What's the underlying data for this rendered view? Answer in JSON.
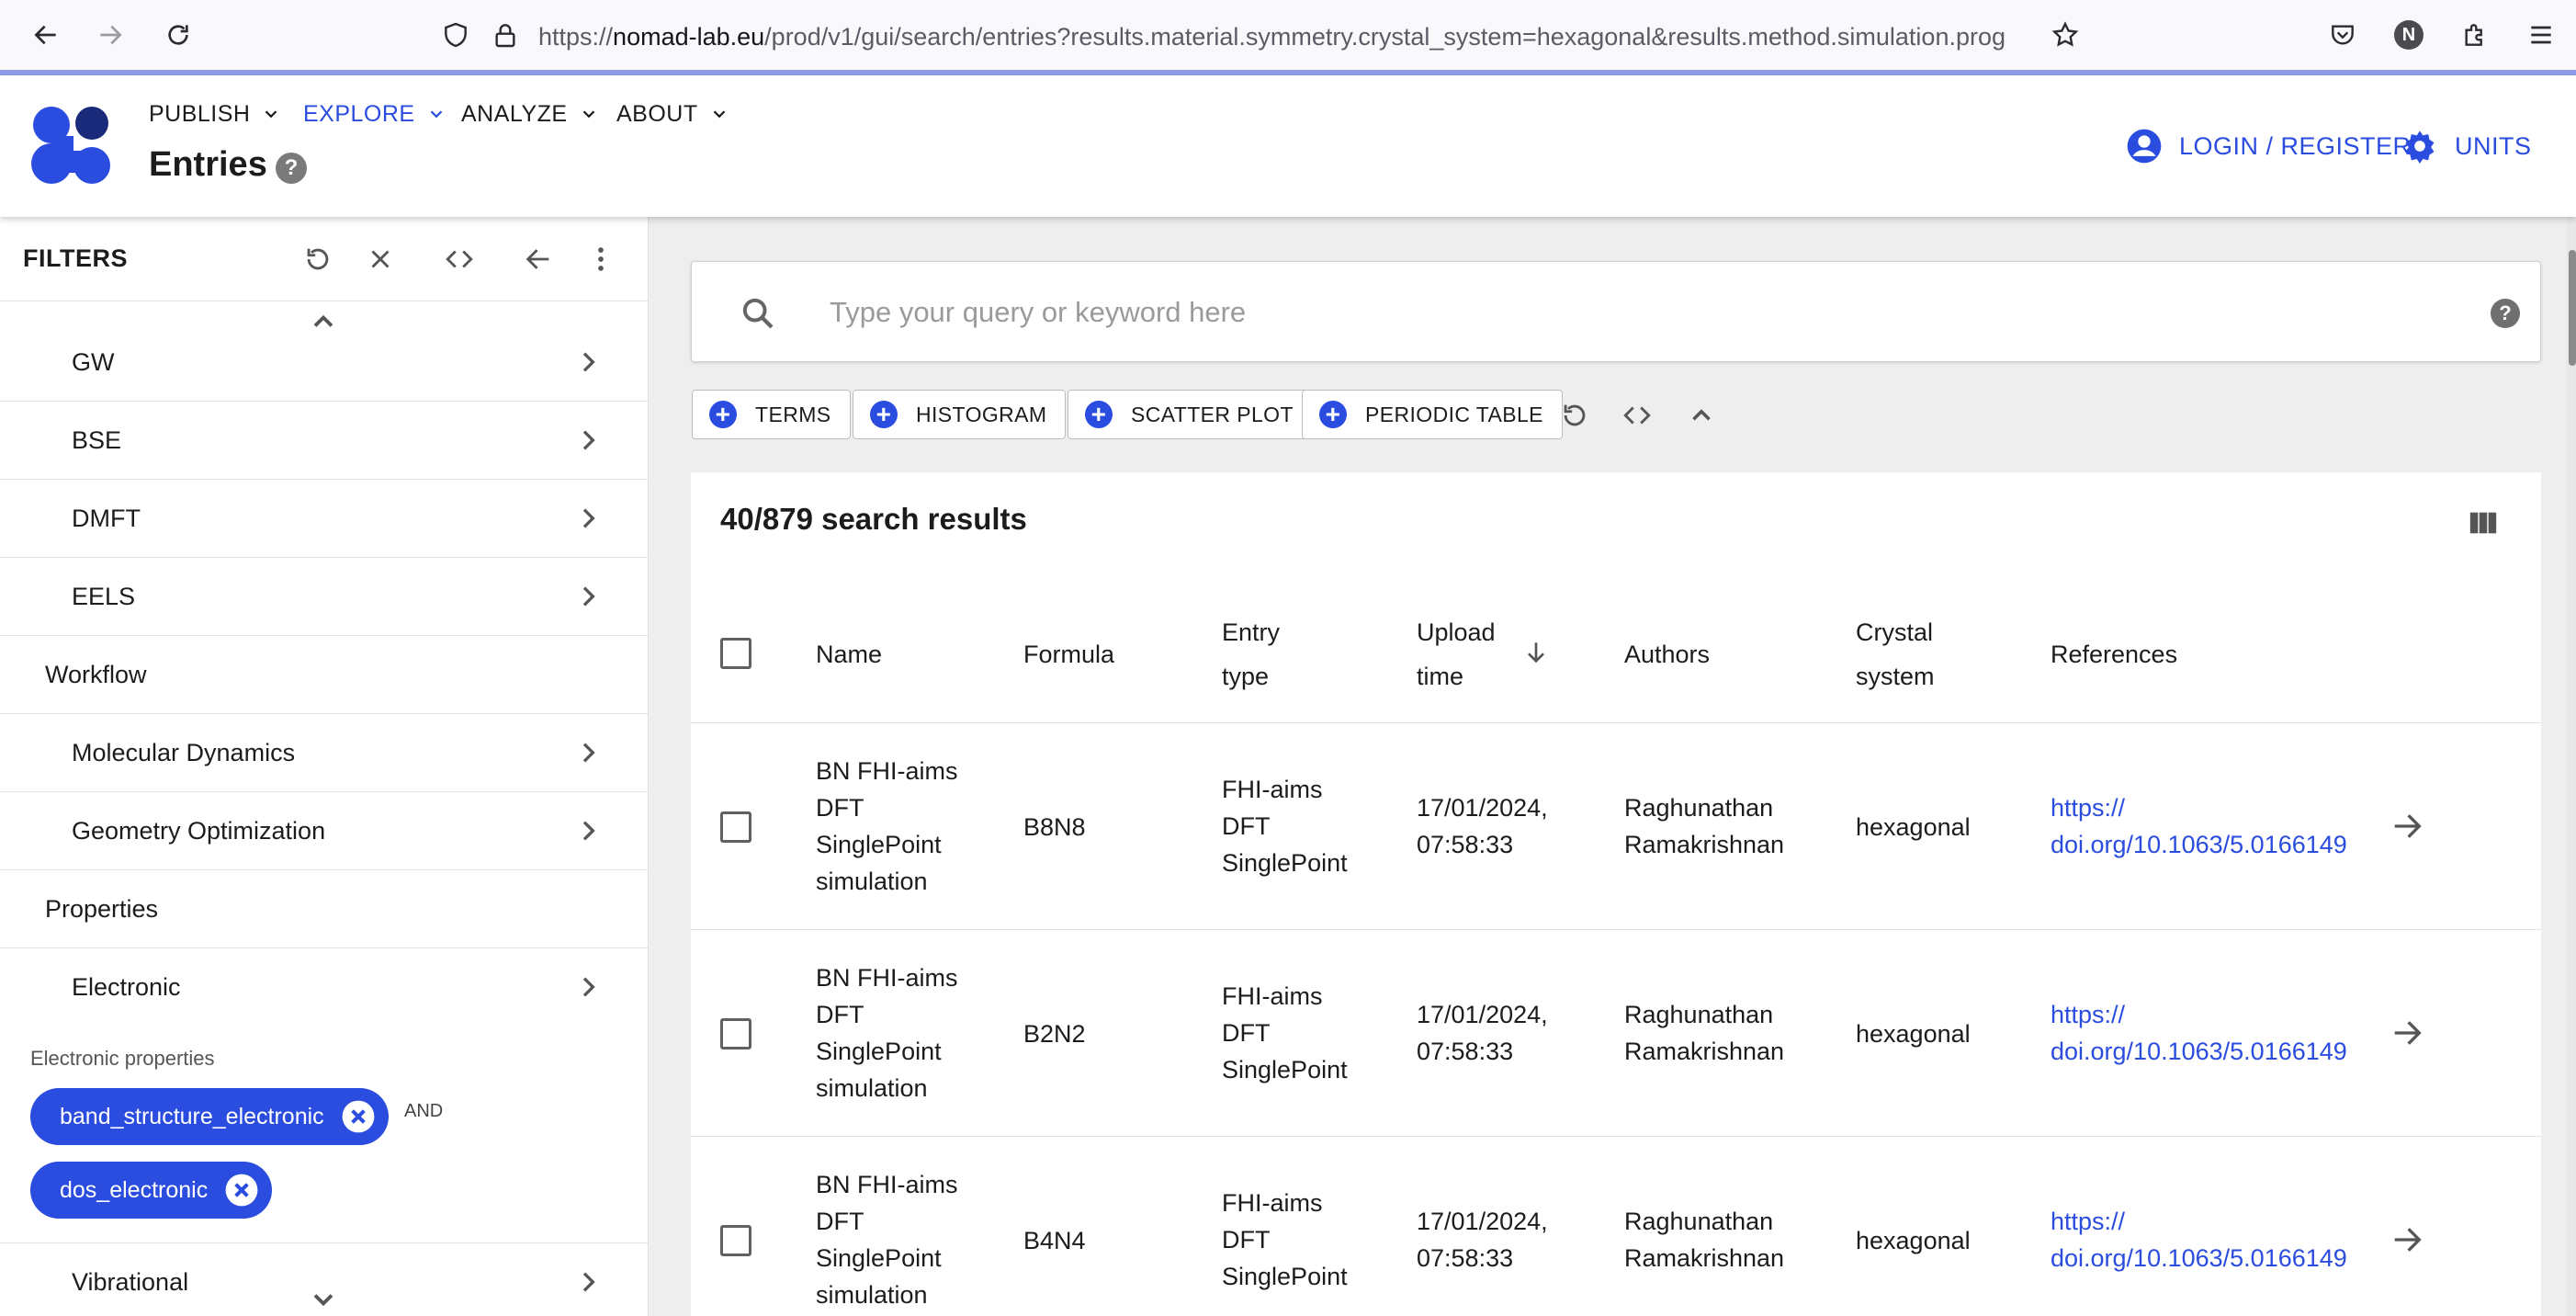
{
  "browser": {
    "url_prefix": "https://",
    "url_host": "nomad-lab.eu",
    "url_path": "/prod/v1/gui/search/entries?results.material.symmetry.crystal_system=hexagonal&results.method.simulation.prog",
    "profile_initial": "N"
  },
  "header": {
    "nav": [
      {
        "label": "PUBLISH"
      },
      {
        "label": "EXPLORE"
      },
      {
        "label": "ANALYZE"
      },
      {
        "label": "ABOUT"
      }
    ],
    "page_title": "Entries",
    "help_glyph": "?",
    "login_label": "LOGIN / REGISTER",
    "units_label": "UNITS"
  },
  "filters": {
    "title": "FILTERS",
    "items": [
      {
        "label": "GW"
      },
      {
        "label": "BSE"
      },
      {
        "label": "DMFT"
      },
      {
        "label": "EELS"
      },
      {
        "label": "Workflow"
      },
      {
        "label": "Molecular Dynamics"
      },
      {
        "label": "Geometry Optimization"
      },
      {
        "label": "Properties"
      },
      {
        "label": "Electronic"
      },
      {
        "label": "Vibrational"
      }
    ],
    "electronic_properties_label": "Electronic properties",
    "chips": [
      "band_structure_electronic",
      "dos_electronic"
    ],
    "and_label": "AND"
  },
  "search": {
    "placeholder": "Type your query or keyword here",
    "help_glyph": "?"
  },
  "widgets": [
    {
      "label": "TERMS"
    },
    {
      "label": "HISTOGRAM"
    },
    {
      "label": "SCATTER PLOT"
    },
    {
      "label": "PERIODIC TABLE"
    }
  ],
  "results": {
    "count": "40/879 search results",
    "columns": {
      "name": "Name",
      "formula": "Formula",
      "entry_type_1": "Entry",
      "entry_type_2": "type",
      "upload_time_1": "Upload",
      "upload_time_2": "time",
      "authors": "Authors",
      "crystal_1": "Crystal",
      "crystal_2": "system",
      "references": "References"
    },
    "rows": [
      {
        "name": [
          "BN FHI-aims",
          "DFT",
          "SinglePoint",
          "simulation"
        ],
        "formula": "B8N8",
        "entry_type": [
          "FHI-aims",
          "DFT",
          "SinglePoint"
        ],
        "upload_time": [
          "17/01/2024,",
          "07:58:33"
        ],
        "authors": [
          "Raghunathan",
          "Ramakrishnan"
        ],
        "crystal_system": "hexagonal",
        "reference": [
          "https://",
          "doi.org/10.1063/5.0166149"
        ]
      },
      {
        "name": [
          "BN FHI-aims",
          "DFT",
          "SinglePoint",
          "simulation"
        ],
        "formula": "B2N2",
        "entry_type": [
          "FHI-aims",
          "DFT",
          "SinglePoint"
        ],
        "upload_time": [
          "17/01/2024,",
          "07:58:33"
        ],
        "authors": [
          "Raghunathan",
          "Ramakrishnan"
        ],
        "crystal_system": "hexagonal",
        "reference": [
          "https://",
          "doi.org/10.1063/5.0166149"
        ]
      },
      {
        "name": [
          "BN FHI-aims",
          "DFT",
          "SinglePoint",
          "simulation"
        ],
        "formula": "B4N4",
        "entry_type": [
          "FHI-aims",
          "DFT",
          "SinglePoint"
        ],
        "upload_time": [
          "17/01/2024,",
          "07:58:33"
        ],
        "authors": [
          "Raghunathan",
          "Ramakrishnan"
        ],
        "crystal_system": "hexagonal",
        "reference": [
          "https://",
          "doi.org/10.1063/5.0166149"
        ]
      }
    ]
  },
  "colors": {
    "accent": "#2a4cdf",
    "logo_light": "#2a4cdf",
    "logo_dark": "#1a2a7a",
    "browser_accent_line": "#8e9be8"
  }
}
